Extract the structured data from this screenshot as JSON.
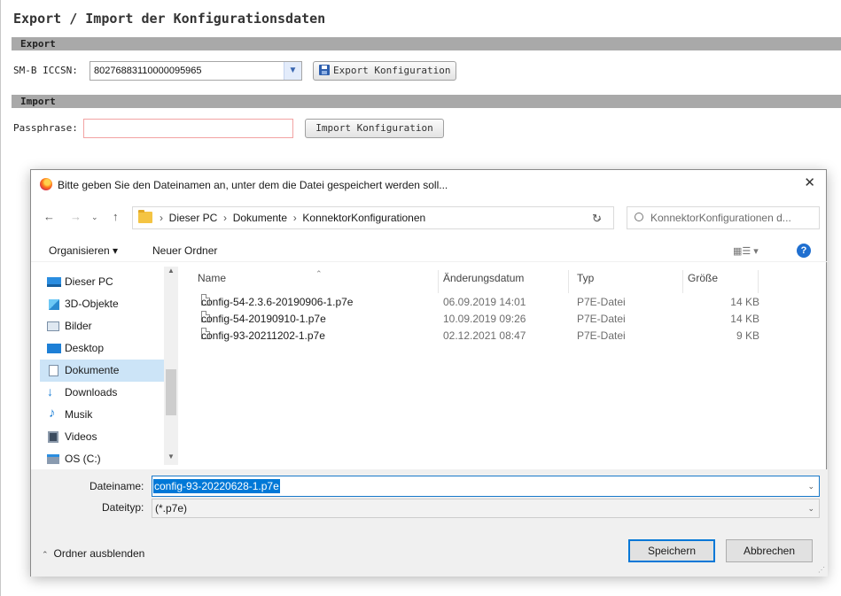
{
  "page": {
    "title": "Export / Import der Konfigurationsdaten",
    "export_section": "Export",
    "import_section": "Import",
    "iccsn_label": "SM-B ICCSN:",
    "iccsn_value": "80276883110000095965",
    "export_button": "Export Konfiguration",
    "passphrase_label": "Passphrase:",
    "passphrase_value": "",
    "import_button": "Import Konfiguration"
  },
  "dialog": {
    "title": "Bitte geben Sie den Dateinamen an, unter dem die Datei gespeichert werden soll...",
    "breadcrumb": [
      "Dieser PC",
      "Dokumente",
      "KonnektorKonfigurationen"
    ],
    "search_placeholder": "KonnektorKonfigurationen d...",
    "toolbar": {
      "organize": "Organisieren ▾",
      "new_folder": "Neuer Ordner"
    },
    "nav_items": [
      {
        "label": "Dieser PC",
        "icon": "pc-icon"
      },
      {
        "label": "3D-Objekte",
        "icon": "cube-icon"
      },
      {
        "label": "Bilder",
        "icon": "pictures-icon"
      },
      {
        "label": "Desktop",
        "icon": "desktop-icon"
      },
      {
        "label": "Dokumente",
        "icon": "documents-icon",
        "selected": true
      },
      {
        "label": "Downloads",
        "icon": "download-icon"
      },
      {
        "label": "Musik",
        "icon": "music-icon"
      },
      {
        "label": "Videos",
        "icon": "video-icon"
      },
      {
        "label": "OS (C:)",
        "icon": "drive-icon"
      }
    ],
    "columns": {
      "name": "Name",
      "date": "Änderungsdatum",
      "type": "Typ",
      "size": "Größe"
    },
    "files": [
      {
        "name": "config-54-2.3.6-20190906-1.p7e",
        "date": "06.09.2019 14:01",
        "type": "P7E-Datei",
        "size": "14 KB"
      },
      {
        "name": "config-54-20190910-1.p7e",
        "date": "10.09.2019 09:26",
        "type": "P7E-Datei",
        "size": "14 KB"
      },
      {
        "name": "config-93-20211202-1.p7e",
        "date": "02.12.2021 08:47",
        "type": "P7E-Datei",
        "size": "9 KB"
      }
    ],
    "filename_label": "Dateiname:",
    "filename_value": "config-93-20220628-1.p7e",
    "filetype_label": "Dateityp:",
    "filetype_value": "(*.p7e)",
    "hide_folders": "Ordner ausblenden",
    "save_button": "Speichern",
    "cancel_button": "Abbrechen"
  }
}
